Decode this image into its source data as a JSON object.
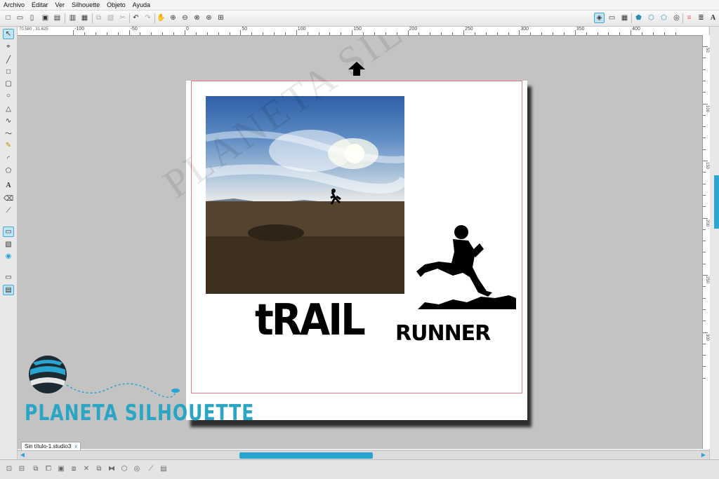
{
  "menu": [
    "Archivo",
    "Editar",
    "Ver",
    "Silhouette",
    "Objeto",
    "Ayuda"
  ],
  "icons": {
    "top_left": [
      "new-icon",
      "open-icon",
      "clipboard-icon",
      "save-icon",
      "save-as-icon",
      "print-icon",
      "send-icon",
      "copy-icon",
      "paste-icon",
      "cut-icon",
      "undo-icon",
      "redo-icon",
      "hand-icon",
      "zoom-in-icon",
      "zoom-out-icon",
      "zoom-fit-icon",
      "zoom-drag-icon",
      "zoom-page-icon"
    ],
    "top_right": [
      "design-page-icon",
      "page-setup-icon",
      "grid-icon",
      "fill-color-icon",
      "line-color-icon",
      "line-style-icon",
      "shadow-icon",
      "layers-icon",
      "align-icon",
      "text-style-icon"
    ],
    "left_tools": [
      "select-icon",
      "edit-points-icon",
      "line-icon",
      "rectangle-icon",
      "rounded-rect-icon",
      "ellipse-icon",
      "polygon-icon",
      "curve-icon",
      "freehand-icon",
      "pencil-icon",
      "arc-icon",
      "regular-polygon-icon",
      "text-icon",
      "eraser-icon",
      "knife-icon"
    ],
    "bottom": [
      "group-icon",
      "ungroup-icon",
      "compound-icon",
      "release-icon",
      "weld-icon",
      "delete-icon",
      "duplicate-icon",
      "mirror-icon",
      "fill-icon",
      "offset-icon",
      "trace-icon",
      "layers-icon"
    ]
  },
  "ruler": {
    "coords": "70.580 , 31.625",
    "h_labels": [
      "-100",
      "-50",
      "0",
      "50",
      "100",
      "150",
      "200",
      "250",
      "300",
      "350",
      "400"
    ],
    "v_labels": [
      "50",
      "100",
      "150",
      "200",
      "250",
      "300"
    ]
  },
  "canvas": {
    "watermark": "PLANETA SILHOUETTE",
    "title_big": "tRAIL",
    "title_small": "RUNNER"
  },
  "brand": {
    "name": "PLANETA SILHOUETTE"
  },
  "doc_tab": {
    "name": "Sin título-1.studio3",
    "close": "x"
  },
  "colors": {
    "accent": "#2aa5d1",
    "cut_line": "#e08080",
    "workspace": "#c3c3c3"
  }
}
